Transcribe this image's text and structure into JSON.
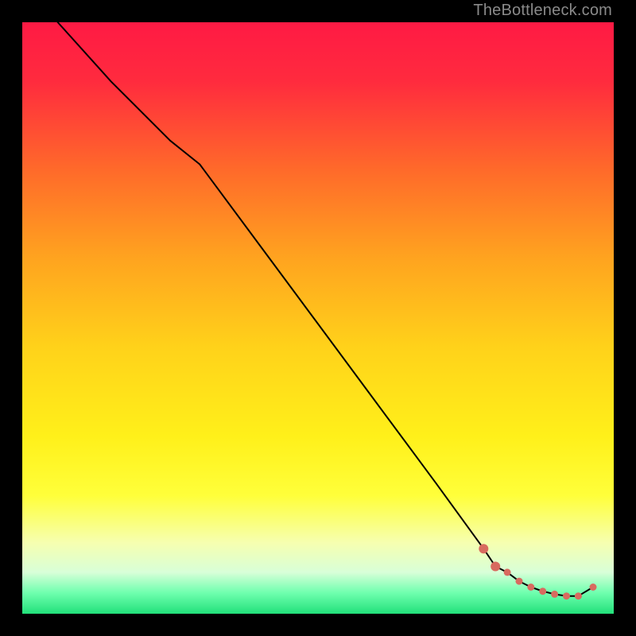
{
  "watermark": "TheBottleneck.com",
  "chart_data": {
    "type": "line",
    "title": "",
    "xlabel": "",
    "ylabel": "",
    "xlim": [
      0,
      100
    ],
    "ylim": [
      0,
      100
    ],
    "grid": false,
    "legend": false,
    "series": [
      {
        "name": "bottleneck-curve",
        "x": [
          6,
          15,
          25,
          30,
          40,
          50,
          60,
          70,
          78,
          80,
          82,
          84,
          86,
          88,
          90,
          92,
          94,
          96.5
        ],
        "y": [
          100,
          90,
          80,
          76,
          62.5,
          49,
          35.5,
          22,
          11,
          8,
          7,
          5.5,
          4.5,
          3.8,
          3.3,
          3.0,
          3.0,
          4.5
        ],
        "stroke": "#000000"
      }
    ],
    "markers": {
      "name": "tail-points",
      "x": [
        78,
        80,
        82,
        84,
        86,
        88,
        90,
        92,
        94,
        96.5
      ],
      "y": [
        11,
        8,
        7,
        5.5,
        4.5,
        3.8,
        3.3,
        3.0,
        3.0,
        4.5
      ],
      "color": "#d86a5f"
    },
    "gradient_stops": [
      {
        "offset": 0.0,
        "color": "#ff1a44"
      },
      {
        "offset": 0.1,
        "color": "#ff2b3e"
      },
      {
        "offset": 0.25,
        "color": "#ff6a2a"
      },
      {
        "offset": 0.4,
        "color": "#ffa41f"
      },
      {
        "offset": 0.55,
        "color": "#ffd21a"
      },
      {
        "offset": 0.7,
        "color": "#fff01a"
      },
      {
        "offset": 0.8,
        "color": "#ffff3a"
      },
      {
        "offset": 0.88,
        "color": "#f6ffb0"
      },
      {
        "offset": 0.93,
        "color": "#d8ffd8"
      },
      {
        "offset": 0.965,
        "color": "#6effae"
      },
      {
        "offset": 1.0,
        "color": "#22e07a"
      }
    ]
  }
}
